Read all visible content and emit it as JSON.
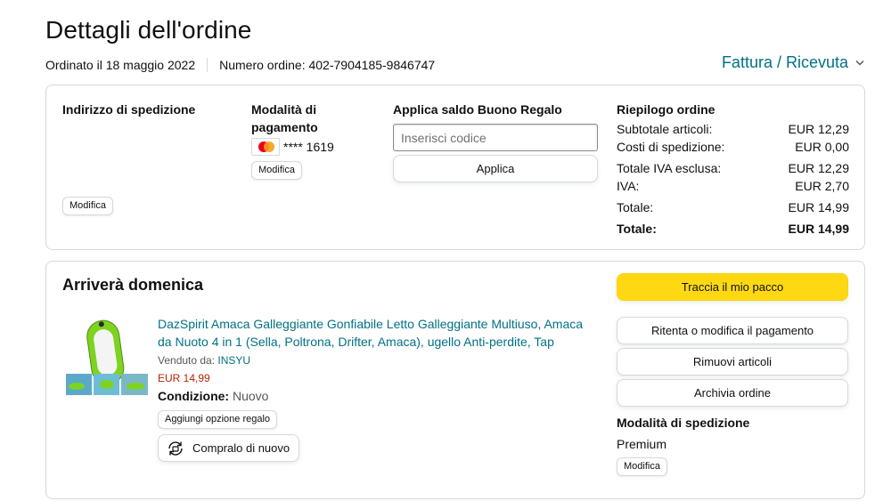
{
  "header": {
    "title": "Dettagli dell'ordine",
    "ordered": "Ordinato il 18 maggio 2022",
    "order_number": "Numero ordine: 402-7904185-9846747",
    "invoice_link": "Fattura / Ricevuta"
  },
  "shipping_address": {
    "title": "Indirizzo di spedizione",
    "edit_label": "Modifica"
  },
  "payment": {
    "title": "Modalità di pagamento",
    "card_brand": "Mastercard",
    "card_masked": "**** 1619",
    "edit_label": "Modifica"
  },
  "gift_card": {
    "title": "Applica saldo Buono Regalo",
    "placeholder": "Inserisci codice",
    "apply_label": "Applica"
  },
  "summary": {
    "title": "Riepilogo ordine",
    "rows": [
      {
        "label": "Subtotale articoli:",
        "value": "EUR 12,29"
      },
      {
        "label": "Costi di spedizione:",
        "value": "EUR 0,00"
      },
      {
        "label": "Totale IVA esclusa:",
        "value": "EUR 12,29"
      },
      {
        "label": "IVA:",
        "value": "EUR 2,70"
      },
      {
        "label": "Totale:",
        "value": "EUR 14,99"
      },
      {
        "label": "Totale:",
        "value": "EUR 14,99"
      }
    ]
  },
  "delivery": {
    "title": "Arriverà domenica",
    "product": {
      "title": "DazSpirit Amaca Galleggiante Gonfiabile Letto Galleggiante Multiuso, Amaca da Nuoto 4 in 1 (Sella, Poltrona, Drifter, Amaca), ugello Anti-perdite, Tap",
      "sold_by_label": "Venduto da:",
      "seller": "INSYU",
      "price": "EUR 14,99",
      "condition_label": "Condizione:",
      "condition": "Nuovo",
      "gift_option_label": "Aggiungi opzione regalo",
      "buy_again_label": "Compralo di nuovo"
    },
    "actions": {
      "track": "Traccia il mio pacco",
      "retry_payment": "Ritenta o modifica il pagamento",
      "remove_items": "Rimuovi articoli",
      "archive": "Archivia ordine"
    },
    "shipping_method": {
      "title": "Modalità di spedizione",
      "value": "Premium",
      "edit_label": "Modifica"
    }
  },
  "colors": {
    "link": "#007185",
    "price": "#b12704",
    "primary_button": "#ffd814",
    "border": "#d5d9d9",
    "product_green": "#7ed321"
  }
}
